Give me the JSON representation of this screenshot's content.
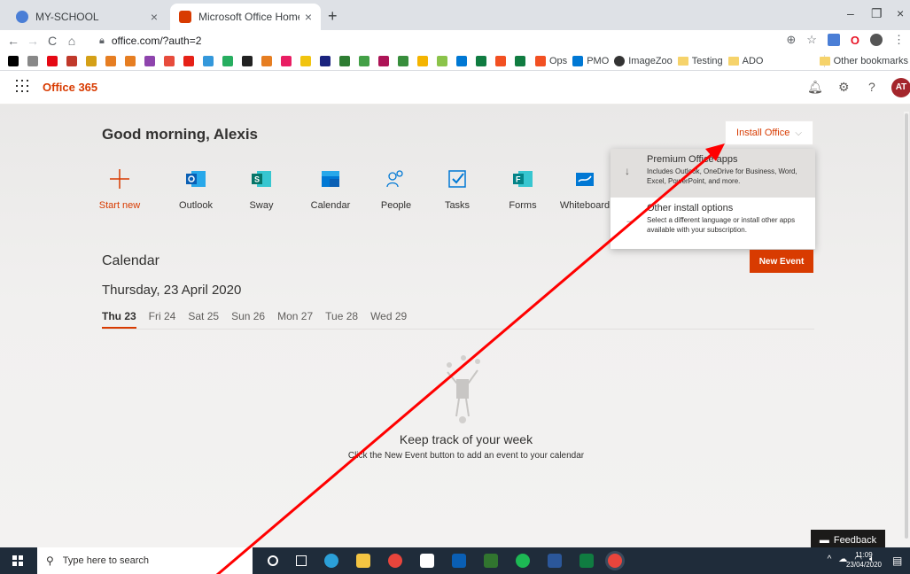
{
  "browser": {
    "tabs": [
      {
        "label": "MY-SCHOOL",
        "active": false,
        "icon": "people-icon",
        "color": "#4a7ed6"
      },
      {
        "label": "Microsoft Office Home",
        "active": true,
        "icon": "office-icon",
        "color": "#d83b01"
      }
    ],
    "url": "office.com/?auth=2",
    "bookmarks_named": [
      {
        "label": "Ops",
        "color": "#f25022"
      },
      {
        "label": "PMO",
        "color": "#0078d4"
      },
      {
        "label": "ImageZoo",
        "color": "#333333"
      },
      {
        "label": "Testing",
        "color": "#f6d36b"
      },
      {
        "label": "ADO",
        "color": "#f6d36b"
      }
    ],
    "other_bookmarks": "Other bookmarks"
  },
  "header": {
    "app_name": "Office 365",
    "avatar_initials": "AT"
  },
  "main": {
    "greeting": "Good morning, Alexis",
    "install_button": "Install Office",
    "apps": [
      {
        "label": "Start new",
        "icon": "plus-icon"
      },
      {
        "label": "Outlook",
        "icon": "outlook-icon"
      },
      {
        "label": "Sway",
        "icon": "sway-icon"
      },
      {
        "label": "Calendar",
        "icon": "calendar-icon"
      },
      {
        "label": "People",
        "icon": "people-icon"
      },
      {
        "label": "Tasks",
        "icon": "tasks-icon"
      },
      {
        "label": "Forms",
        "icon": "forms-icon"
      },
      {
        "label": "Whiteboard",
        "icon": "whiteboard-icon"
      }
    ],
    "install_menu": [
      {
        "title": "Premium Office apps",
        "desc": "Includes Outlook, OneDrive for Business, Word, Excel, PowerPoint, and more.",
        "icon": "download-icon"
      },
      {
        "title": "Other install options",
        "desc": "Select a different language or install other apps available with your subscription.",
        "icon": "arrow-right-icon"
      }
    ],
    "calendar": {
      "title": "Calendar",
      "new_event": "New Event",
      "date": "Thursday, 23 April 2020",
      "days": [
        "Thu 23",
        "Fri 24",
        "Sat 25",
        "Sun 26",
        "Mon 27",
        "Tue 28",
        "Wed 29"
      ],
      "selected_day": "Thu 23",
      "empty_title": "Keep track of your week",
      "empty_subtitle": "Click the New Event button to add an event to your calendar"
    },
    "feedback": "Feedback"
  },
  "taskbar": {
    "search_placeholder": "Type here to search",
    "time": "11:09",
    "date": "23/04/2020"
  },
  "colors": {
    "accent": "#d83b01",
    "annotation_arrow": "#ff0000"
  }
}
